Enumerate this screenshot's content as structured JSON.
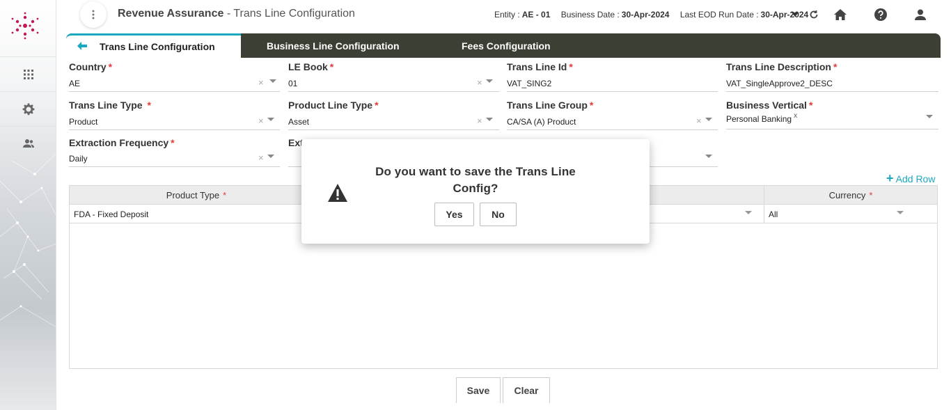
{
  "header": {
    "app_name": "Revenue Assurance",
    "page_name": " - Trans Line Configuration",
    "entity_label": "Entity :",
    "entity_value": "AE - 01",
    "business_date_label": "Business Date :",
    "business_date_value": "30-Apr-2024",
    "eod_label": "Last EOD Run Date :",
    "eod_value": "30-Apr-2024"
  },
  "tabs": [
    {
      "label": "Trans Line Configuration"
    },
    {
      "label": "Business Line Configuration"
    },
    {
      "label": "Fees Configuration"
    }
  ],
  "form": {
    "country": {
      "label": "Country",
      "value": "AE"
    },
    "le_book": {
      "label": "LE Book",
      "value": "01"
    },
    "trans_line_id": {
      "label": "Trans Line Id",
      "value": "VAT_SING2"
    },
    "trans_line_desc": {
      "label": "Trans Line Description",
      "value": "VAT_SingleApprove2_DESC"
    },
    "trans_line_type": {
      "label": "Trans Line Type",
      "value": "Product"
    },
    "product_line_type": {
      "label": "Product Line Type",
      "value": "Asset"
    },
    "trans_line_group": {
      "label": "Trans Line Group",
      "value": "CA/SA (A) Product"
    },
    "business_vertical": {
      "label": "Business Vertical",
      "value": "Personal Banking",
      "remove": "x"
    },
    "extraction_frequency": {
      "label": "Extraction Frequency",
      "value": "Daily"
    },
    "extraction_partial": {
      "label": "Ext"
    }
  },
  "grid": {
    "add_row": "Add Row",
    "columns": [
      {
        "label": "Product Type"
      },
      {
        "label": "Currency"
      }
    ],
    "rows": [
      {
        "product_type": "FDA - Fixed Deposit",
        "currency": "All"
      }
    ]
  },
  "buttons": {
    "save": "Save",
    "clear": "Clear"
  },
  "dialog": {
    "message": "Do you want to save the Trans Line Config?",
    "yes": "Yes",
    "no": "No"
  },
  "colors": {
    "accent": "#1aa8c0",
    "tabbar": "#3c3f34",
    "required": "#e53935"
  }
}
